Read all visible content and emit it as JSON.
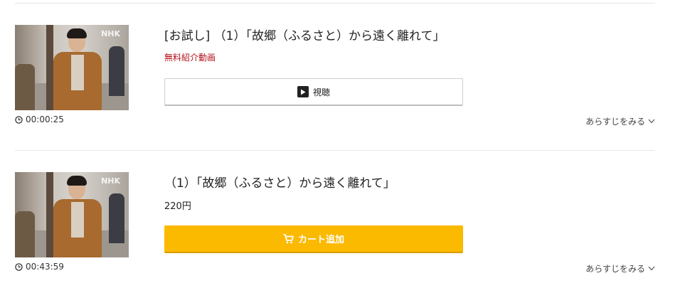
{
  "episodes": [
    {
      "title": "[お試し] （1）「故郷（ふるさと）から遠く離れて」",
      "label": "無料紹介動画",
      "button_label": "視聴",
      "button_icon": "play-icon",
      "duration": "00:00:25",
      "synopsis_label": "あらすじをみる",
      "thumbnail_logo": "NHK"
    },
    {
      "title": "（1）「故郷（ふるさと）から遠く離れて」",
      "price": "220円",
      "button_label": "カート追加",
      "button_icon": "cart-icon",
      "duration": "00:43:59",
      "synopsis_label": "あらすじをみる",
      "thumbnail_logo": "NHK"
    }
  ],
  "colors": {
    "free_label": "#b5121b",
    "cart_button": "#fbb900",
    "divider": "#e6e6e6"
  }
}
